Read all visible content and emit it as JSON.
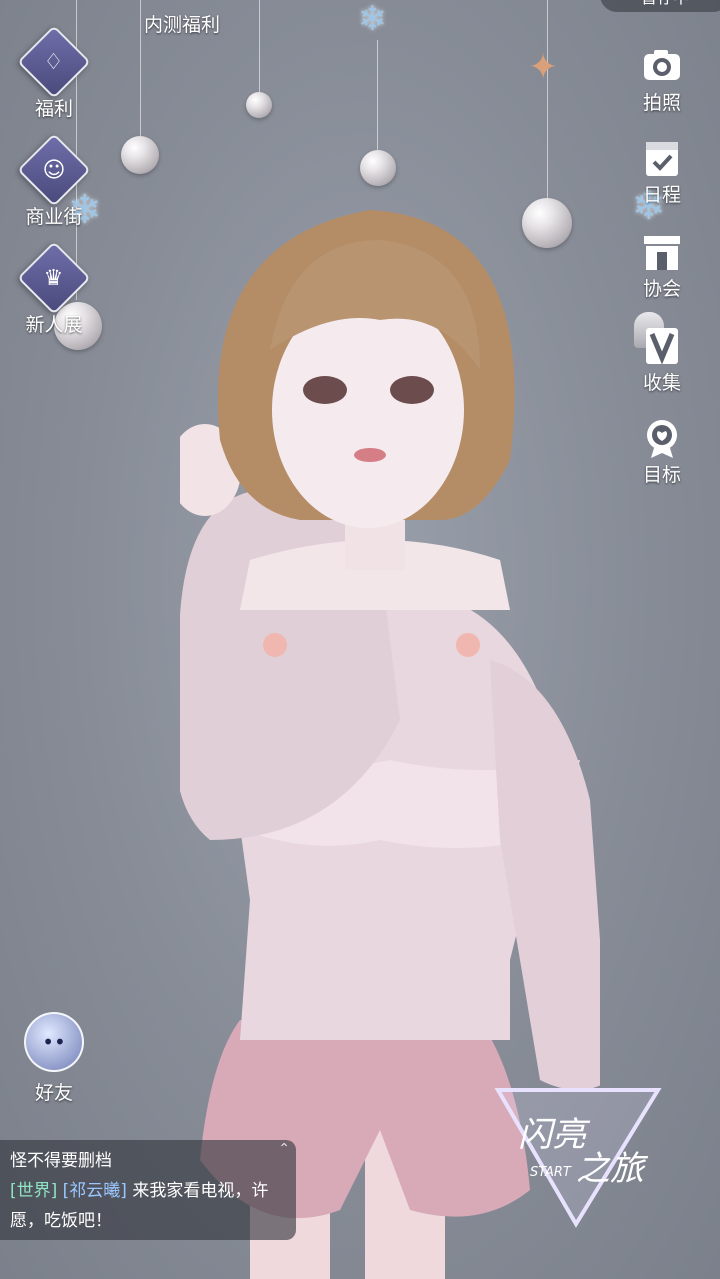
{
  "top_bar": {
    "pill_label": "暂存中"
  },
  "left_menu": [
    {
      "label": "福利",
      "icon": "balloon-icon"
    },
    {
      "label": "商业街",
      "icon": "shopping-bag-icon"
    },
    {
      "label": "新人展",
      "icon": "crown-badge-icon"
    }
  ],
  "top_center": {
    "label": "内测福利",
    "icon": "gift-icon"
  },
  "right_menu": [
    {
      "label": "拍照",
      "icon": "camera-icon"
    },
    {
      "label": "日程",
      "icon": "calendar-check-icon"
    },
    {
      "label": "协会",
      "icon": "building-icon"
    },
    {
      "label": "收集",
      "icon": "collection-icon"
    },
    {
      "label": "目标",
      "icon": "medal-icon"
    }
  ],
  "friends": {
    "label": "好友",
    "icon": "friends-bubble-icon"
  },
  "chat": {
    "line1": "怪不得要删档",
    "channel": "[世界]",
    "user": "[祁云曦]",
    "message": "来我家看电视，许愿，吃饭吧！"
  },
  "logo": {
    "title_a": "闪亮",
    "title_b": "之旅",
    "subtitle": "START"
  }
}
